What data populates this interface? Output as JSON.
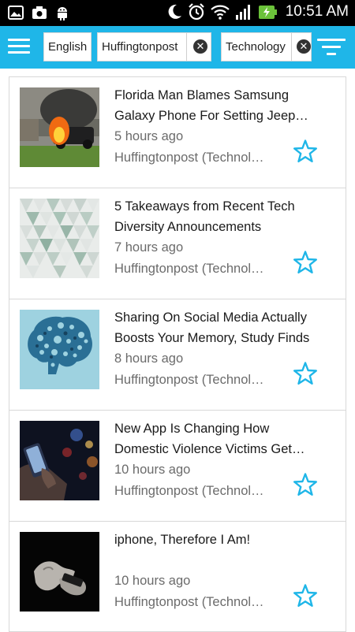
{
  "status_bar": {
    "time": "10:51 AM",
    "icons": [
      "photo-icon",
      "camera-icon",
      "android-icon",
      "moon-icon",
      "alarm-icon",
      "wifi-icon",
      "signal-icon",
      "battery-charging-icon"
    ]
  },
  "toolbar": {
    "language_chip": "English",
    "source_chip": "Huffingtonpost",
    "category_chip": "Technology",
    "clear_symbol": "✕"
  },
  "colors": {
    "accent": "#1fb6e8",
    "star": "#1fb6e8"
  },
  "articles": [
    {
      "title": "Florida Man Blames Samsung Galaxy Phone For Setting Jeep…",
      "time": "5 hours ago",
      "source": "Huffingtonpost (Technol…",
      "thumb": "burning-car-image"
    },
    {
      "title": "5 Takeaways from Recent Tech Diversity Announcements",
      "time": "7 hours ago",
      "source": "Huffingtonpost (Technol…",
      "thumb": "triangle-pattern-image"
    },
    {
      "title": "Sharing On Social Media Actually Boosts Your Memory, Study Finds",
      "time": "8 hours ago",
      "source": "Huffingtonpost (Technol…",
      "thumb": "brain-icons-image"
    },
    {
      "title": "New App Is Changing How Domestic Violence Victims Get…",
      "time": "10 hours ago",
      "source": "Huffingtonpost (Technol…",
      "thumb": "phone-night-image"
    },
    {
      "title": "iphone, Therefore I Am!",
      "time": "10 hours ago",
      "source": "Huffingtonpost (Technol…",
      "thumb": "hands-phone-image"
    }
  ]
}
